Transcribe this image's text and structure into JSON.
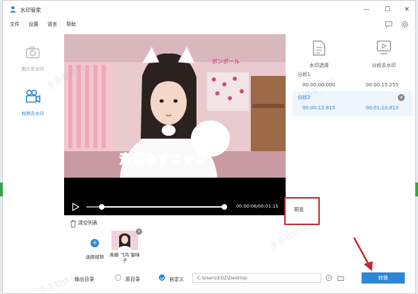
{
  "app": {
    "title": "水印管家",
    "brand_color": "#2d87d2",
    "icon": "app-logo-icon"
  },
  "window_controls": {
    "minimize": "—",
    "maximize": "☐",
    "close": "✕"
  },
  "menu": {
    "items": [
      "文件",
      "设置",
      "语言",
      "帮助"
    ]
  },
  "sidebar": {
    "items": [
      {
        "label": "图片去水印",
        "icon": "image-icon",
        "active": false
      },
      {
        "label": "视频去水印",
        "icon": "video-camera-icon",
        "active": true
      }
    ]
  },
  "player": {
    "time_text": "00:00:06/00:01:15",
    "progress": 0.08,
    "segment_start": 0.11,
    "segment_end": 0.99,
    "video_caption": "斎藤あすニャン",
    "video_banner": "ボンボール"
  },
  "right_panel": {
    "tool_left": "水印选择",
    "tool_right": "分段去水印",
    "segments": [
      {
        "title": "分段1",
        "start": "00:00:00.000",
        "end": "00:00:15.255",
        "selected": false
      },
      {
        "title": "分段2",
        "start": "00:00:12.815",
        "end": "00:01:10.813",
        "selected": true
      }
    ],
    "delete_badge": "×",
    "preview_label": "预览"
  },
  "list": {
    "clear_label": "清空列表",
    "select_label": "选择视频",
    "video_item_label": "斋藤 飞鸟 猫咪子",
    "remove_badge": "×"
  },
  "bottom": {
    "output_label": "输出目录",
    "option_original": "原目录",
    "option_custom": "自定义",
    "path_value": "C:\\Users\\EDZ\\Desktop",
    "convert_label": "转换"
  },
  "watermark": {
    "text": "多多软件站"
  }
}
